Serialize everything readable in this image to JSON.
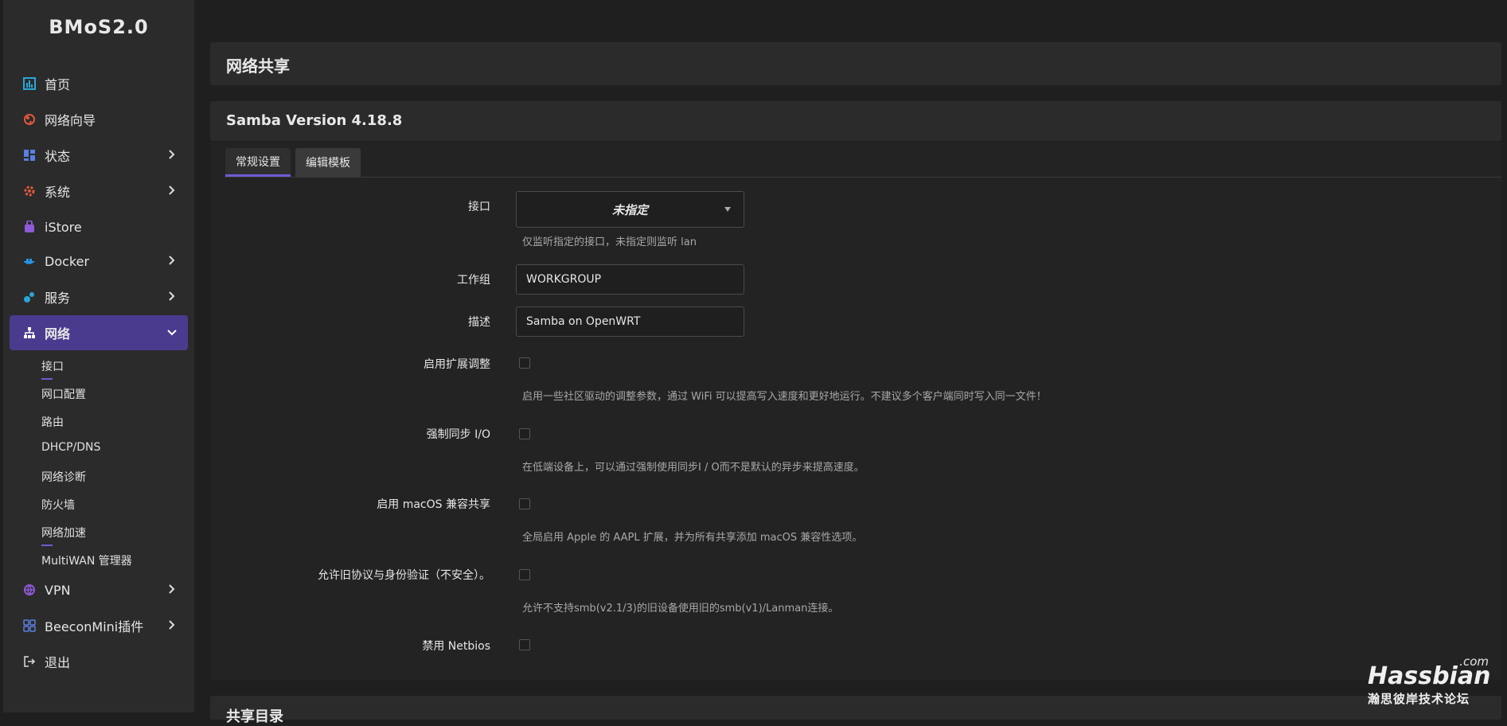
{
  "brand": "BMoS2.0",
  "sidebar": {
    "items": [
      {
        "label": "首页",
        "icon": "dashboard-icon"
      },
      {
        "label": "网络向导",
        "icon": "globe-icon"
      },
      {
        "label": "状态",
        "icon": "grid-icon"
      },
      {
        "label": "系统",
        "icon": "gear-icon"
      },
      {
        "label": "iStore",
        "icon": "store-bag-icon"
      },
      {
        "label": "Docker",
        "icon": "docker-whale-icon"
      },
      {
        "label": "服务",
        "icon": "services-gears-icon"
      },
      {
        "label": "网络",
        "icon": "network-tree-icon"
      },
      {
        "label": "VPN",
        "icon": "vpn-globe-icon"
      },
      {
        "label": "BeeconMini插件",
        "icon": "apps-grid-icon"
      },
      {
        "label": "退出",
        "icon": "logout-icon"
      }
    ],
    "network_sub": [
      "接口",
      "网口配置",
      "路由",
      "DHCP/DNS",
      "网络诊断",
      "防火墙",
      "网络加速",
      "MultiWAN 管理器"
    ]
  },
  "main": {
    "page_title": "网络共享",
    "section_title": "Samba Version 4.18.8",
    "tabs": [
      "常规设置",
      "编辑模板"
    ],
    "form": {
      "interface_label": "接口",
      "interface_value": "未指定",
      "interface_help": "仅监听指定的接口，未指定则监听 lan",
      "workgroup_label": "工作组",
      "workgroup_value": "WORKGROUP",
      "desc_label": "描述",
      "desc_value": "Samba on OpenWRT",
      "tuning_label": "启用扩展调整",
      "tuning_help": "启用一些社区驱动的调整参数，通过 WiFi 可以提高写入速度和更好地运行。不建议多个客户端同时写入同一文件！",
      "sync_label": "强制同步 I/O",
      "sync_help": "在低端设备上，可以通过强制使用同步I / O而不是默认的异步来提高速度。",
      "macos_label": "启用 macOS 兼容共享",
      "macos_help": "全局启用 Apple 的 AAPL 扩展，并为所有共享添加 macOS 兼容性选项。",
      "legacy_label": "允许旧协议与身份验证（不安全）。",
      "legacy_help": "允许不支持smb(v2.1/3)的旧设备使用旧的smb(v1)/Lanman连接。",
      "netbios_label": "禁用 Netbios"
    },
    "next_section_title": "共享目录"
  },
  "watermark": {
    "brand": "Hassbian",
    "tld": ".com",
    "tagline": "瀚思彼岸技术论坛"
  },
  "colors": {
    "accent": "#4b3b8e",
    "accent_line": "#6c5dd3",
    "sidebar_bg": "#2b2b2b",
    "page_bg": "#1f1f1f"
  }
}
